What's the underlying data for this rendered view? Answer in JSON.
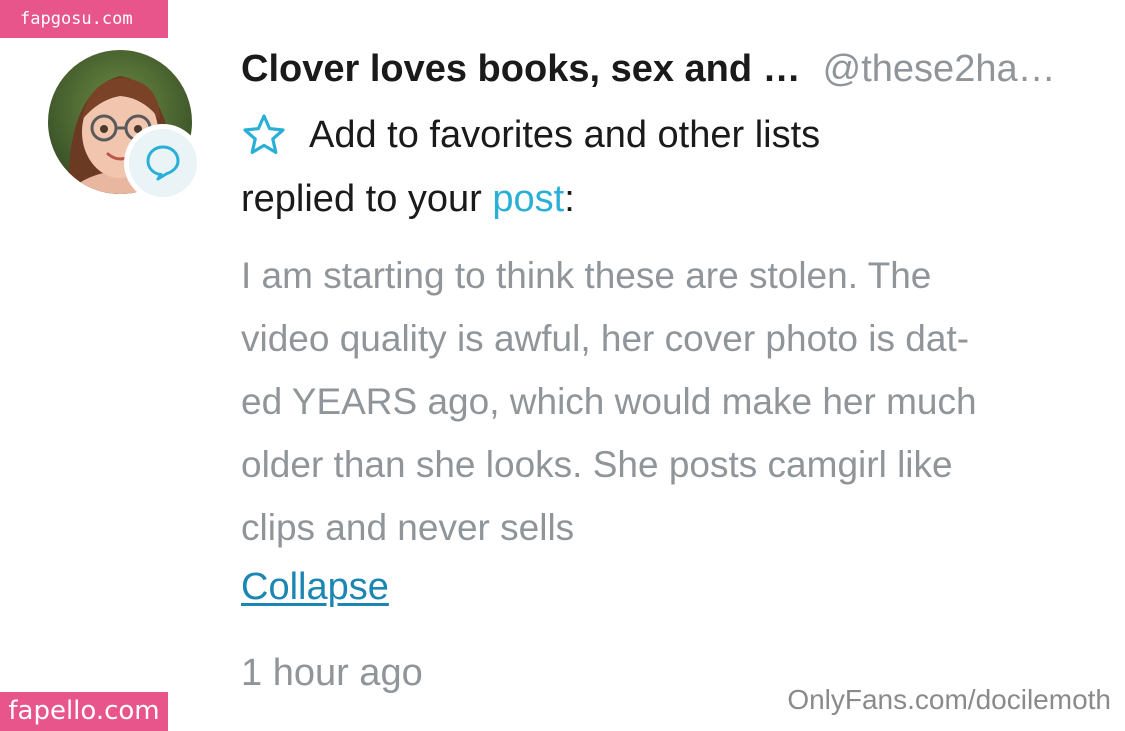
{
  "watermarks": {
    "top_left": "fapgosu.com",
    "bottom_left": "fapello.com",
    "bottom_right": "OnlyFans.com/docilemoth"
  },
  "notification": {
    "user_name": "Clover loves books, sex and …",
    "user_handle": "@these2ha…",
    "favorites_label": "Add to favorites and other lists",
    "replied_prefix": "replied to your ",
    "post_link": "post",
    "replied_suffix": ":",
    "comment_text": "I am starting to think these are stolen. The video quality is awful, her cover photo is dated YEARS ago, which would make her much older than she looks. She posts camgirl like clips and never sells",
    "collapse_label": "Collapse",
    "timestamp": "1 hour ago"
  },
  "icons": {
    "badge": "comment-bubble-icon",
    "favorite": "star-outline-icon"
  },
  "colors": {
    "accent": "#2ab0d6",
    "link": "#1b86b3",
    "muted_text": "#8f9599",
    "watermark_pink": "#e7558b"
  }
}
